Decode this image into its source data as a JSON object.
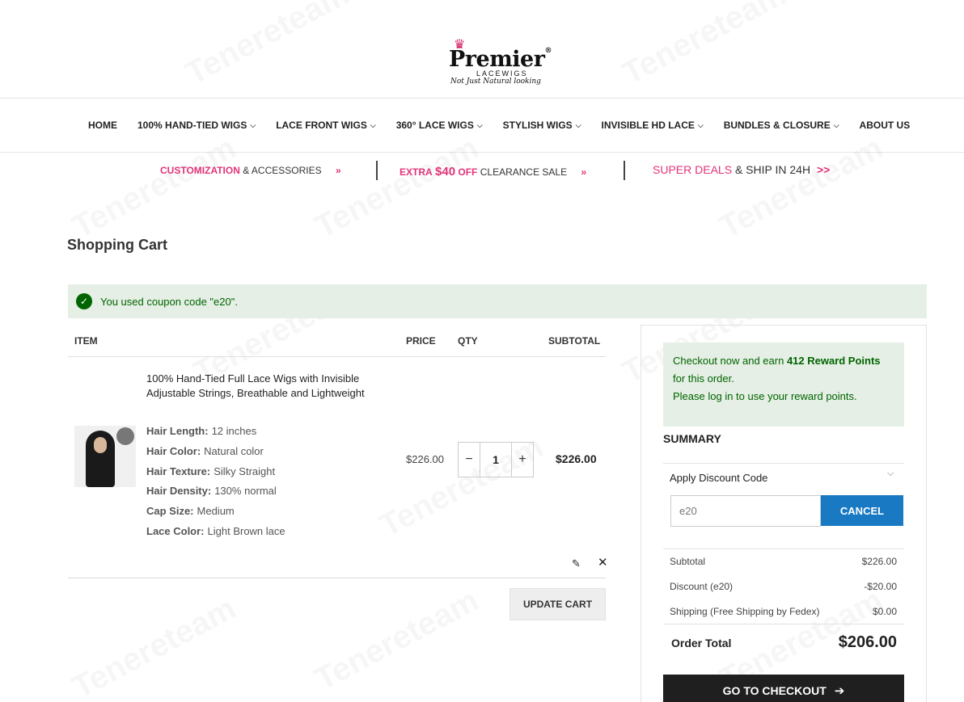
{
  "brand": {
    "name": "Premier",
    "sub": "LACEWIGS",
    "tagline": "Not Just Natural looking",
    "accent": "#d4145a"
  },
  "nav": [
    {
      "label": "HOME",
      "dropdown": false
    },
    {
      "label": "100% HAND-TIED WIGS",
      "dropdown": true
    },
    {
      "label": "LACE FRONT WIGS",
      "dropdown": true
    },
    {
      "label": "360° LACE WIGS",
      "dropdown": true
    },
    {
      "label": "STYLISH WIGS",
      "dropdown": true
    },
    {
      "label": "INVISIBLE HD LACE",
      "dropdown": true
    },
    {
      "label": "BUNDLES & CLOSURE",
      "dropdown": true
    },
    {
      "label": "ABOUT US",
      "dropdown": false
    }
  ],
  "promo": {
    "p1_a": "CUSTOMIZATION",
    "p1_b": "& ACCESSORIES",
    "p1_arrow": "»",
    "p2_a": "EXTRA",
    "p2_b": "$40",
    "p2_c": "OFF",
    "p2_d": "CLEARANCE SALE",
    "p2_arrow": "»",
    "p3_a": "SUPER DEALS",
    "p3_b": "& SHIP IN 24H",
    "p3_arrow": ">>"
  },
  "page": {
    "title": "Shopping Cart",
    "message": "You used coupon code \"e20\".",
    "watermark": "Tenereteam"
  },
  "cart": {
    "headers": {
      "item": "ITEM",
      "price": "PRICE",
      "qty": "QTY",
      "subtotal": "SUBTOTAL"
    },
    "item": {
      "name": "100% Hand-Tied Full Lace Wigs with Invisible Adjustable Strings, Breathable and Lightweight",
      "options": [
        {
          "label": "Hair Length:",
          "value": "12 inches"
        },
        {
          "label": "Hair Color:",
          "value": "Natural color"
        },
        {
          "label": "Hair Texture:",
          "value": "Silky Straight"
        },
        {
          "label": "Hair Density:",
          "value": "130% normal"
        },
        {
          "label": "Cap Size:",
          "value": "Medium"
        },
        {
          "label": "Lace Color:",
          "value": "Light Brown lace"
        }
      ],
      "price": "$226.00",
      "qty": "1",
      "qty_minus": "−",
      "qty_plus": "+",
      "subtotal": "$226.00"
    },
    "update_label": "UPDATE CART"
  },
  "sidebar": {
    "reward_pre": "Checkout now and earn ",
    "reward_points": "412 Reward Points",
    "reward_post": "for this order.",
    "reward_login": "Please log in to use your reward points.",
    "summary_title": "SUMMARY",
    "discount_head": "Apply Discount Code",
    "discount_value": "e20",
    "cancel_label": "CANCEL",
    "totals": [
      {
        "label": "Subtotal",
        "value": "$226.00"
      },
      {
        "label": "Discount (e20)",
        "value": "-$20.00"
      },
      {
        "label": "Shipping (Free Shipping by Fedex)",
        "value": "$0.00"
      }
    ],
    "order_total_label": "Order Total",
    "order_total_value": "$206.00",
    "checkout_label": "GO TO CHECKOUT",
    "button_blue": "#1979c3",
    "success_green": "#006400"
  }
}
